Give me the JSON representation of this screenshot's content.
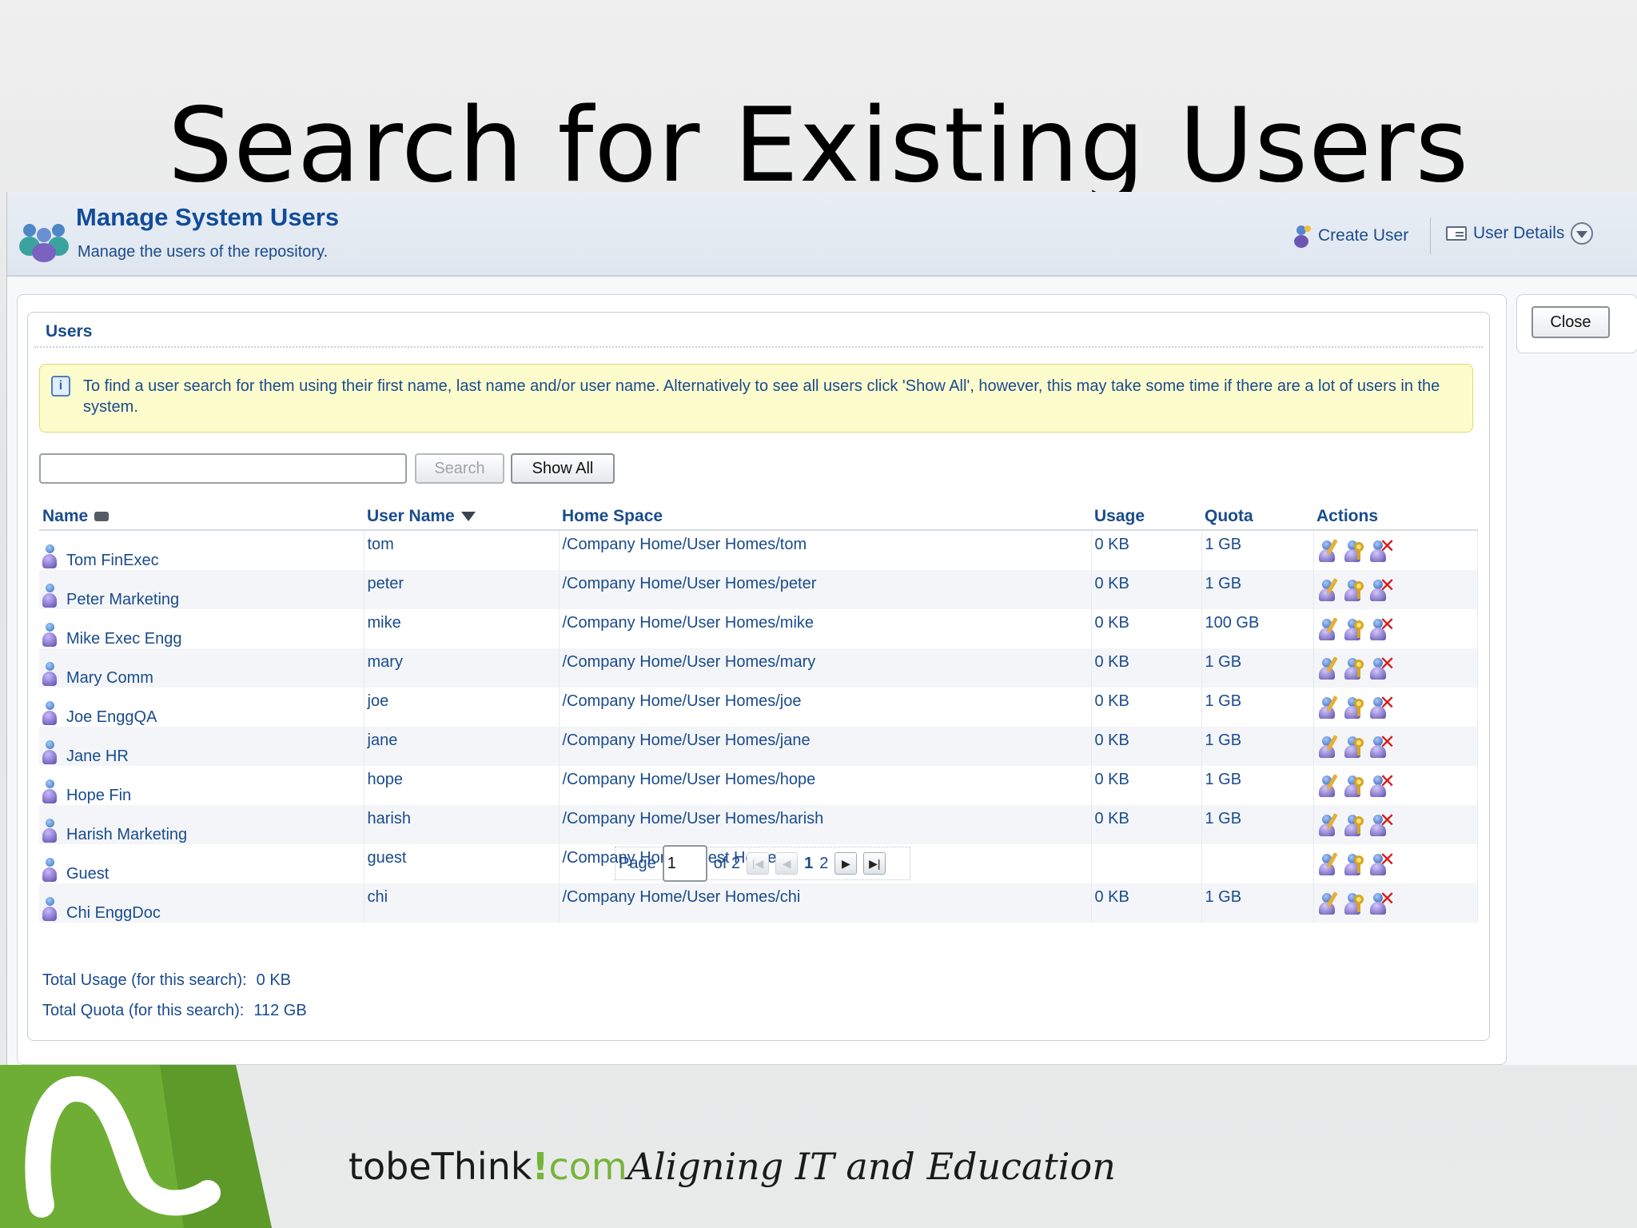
{
  "slide": {
    "title": "Search for Existing Users"
  },
  "header": {
    "title": "Manage System Users",
    "subtitle": "Manage the users of the repository.",
    "create_user_label": "Create User",
    "user_details_label": "User Details"
  },
  "close_label": "Close",
  "users_panel": {
    "title": "Users",
    "info_text": "To find a user search for them using their first name, last name and/or user name. Alternatively to see all users click 'Show All', however, this may take some time if there are a lot of users in the system.",
    "search_placeholder": "",
    "search_label": "Search",
    "show_all_label": "Show All",
    "columns": [
      "Name",
      "User Name",
      "Home Space",
      "Usage",
      "Quota",
      "Actions"
    ],
    "rows": [
      {
        "name": "Tom FinExec",
        "user": "tom",
        "home": "/Company Home/User Homes/tom",
        "usage": "0 KB",
        "quota": "1 GB"
      },
      {
        "name": "Peter Marketing",
        "user": "peter",
        "home": "/Company Home/User Homes/peter",
        "usage": "0 KB",
        "quota": "1 GB"
      },
      {
        "name": "Mike Exec Engg",
        "user": "mike",
        "home": "/Company Home/User Homes/mike",
        "usage": "0 KB",
        "quota": "100 GB"
      },
      {
        "name": "Mary Comm",
        "user": "mary",
        "home": "/Company Home/User Homes/mary",
        "usage": "0 KB",
        "quota": "1 GB"
      },
      {
        "name": "Joe EnggQA",
        "user": "joe",
        "home": "/Company Home/User Homes/joe",
        "usage": "0 KB",
        "quota": "1 GB"
      },
      {
        "name": "Jane HR",
        "user": "jane",
        "home": "/Company Home/User Homes/jane",
        "usage": "0 KB",
        "quota": "1 GB"
      },
      {
        "name": "Hope Fin",
        "user": "hope",
        "home": "/Company Home/User Homes/hope",
        "usage": "0 KB",
        "quota": "1 GB"
      },
      {
        "name": "Harish Marketing",
        "user": "harish",
        "home": "/Company Home/User Homes/harish",
        "usage": "0 KB",
        "quota": "1 GB"
      },
      {
        "name": "Guest",
        "user": "guest",
        "home": "/Company Home/Guest Home",
        "usage": "",
        "quota": ""
      },
      {
        "name": "Chi EnggDoc",
        "user": "chi",
        "home": "/Company Home/User Homes/chi",
        "usage": "0 KB",
        "quota": "1 GB"
      }
    ],
    "pager": {
      "page_label": "Page",
      "current_page": "1",
      "of_label": "of 2",
      "page_1": "1",
      "page_2": "2"
    },
    "total_usage_label": "Total Usage (for this search):",
    "total_usage_value": "0 KB",
    "total_quota_label": "Total Quota (for this search):",
    "total_quota_value": "112 GB"
  },
  "footer": {
    "brand_main": "tobeThink",
    "brand_bang": "!",
    "brand_com": "com",
    "brand_tagline": "Aligning IT and Education"
  },
  "colors": {
    "accent": "#1a4b8c",
    "info_bg": "#fdfccd",
    "brand_green": "#77b43a",
    "delete_red": "#d81818"
  }
}
